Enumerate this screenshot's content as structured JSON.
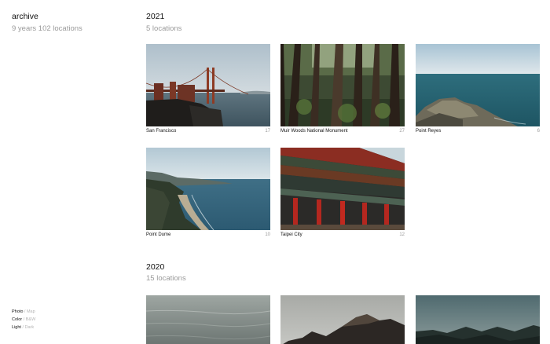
{
  "sidebar": {
    "title": "archive",
    "subtitle": "9 years 102 locations",
    "toggles": [
      {
        "active": "Photo",
        "sep": " / ",
        "inactive": "Map"
      },
      {
        "active": "Color",
        "sep": " / ",
        "inactive": "B&W"
      },
      {
        "active": "Light",
        "sep": " / ",
        "inactive": "Dark"
      }
    ]
  },
  "years": [
    {
      "year": "2021",
      "locations_label": "5 locations",
      "items": [
        {
          "name": "San Francisco",
          "count": "17"
        },
        {
          "name": "Muir Woods National Monument",
          "count": "27"
        },
        {
          "name": "Point Reyes",
          "count": "6"
        },
        {
          "name": "Point Dume",
          "count": "10"
        },
        {
          "name": "Taipei City",
          "count": "12"
        }
      ]
    },
    {
      "year": "2020",
      "locations_label": "15 locations"
    }
  ]
}
